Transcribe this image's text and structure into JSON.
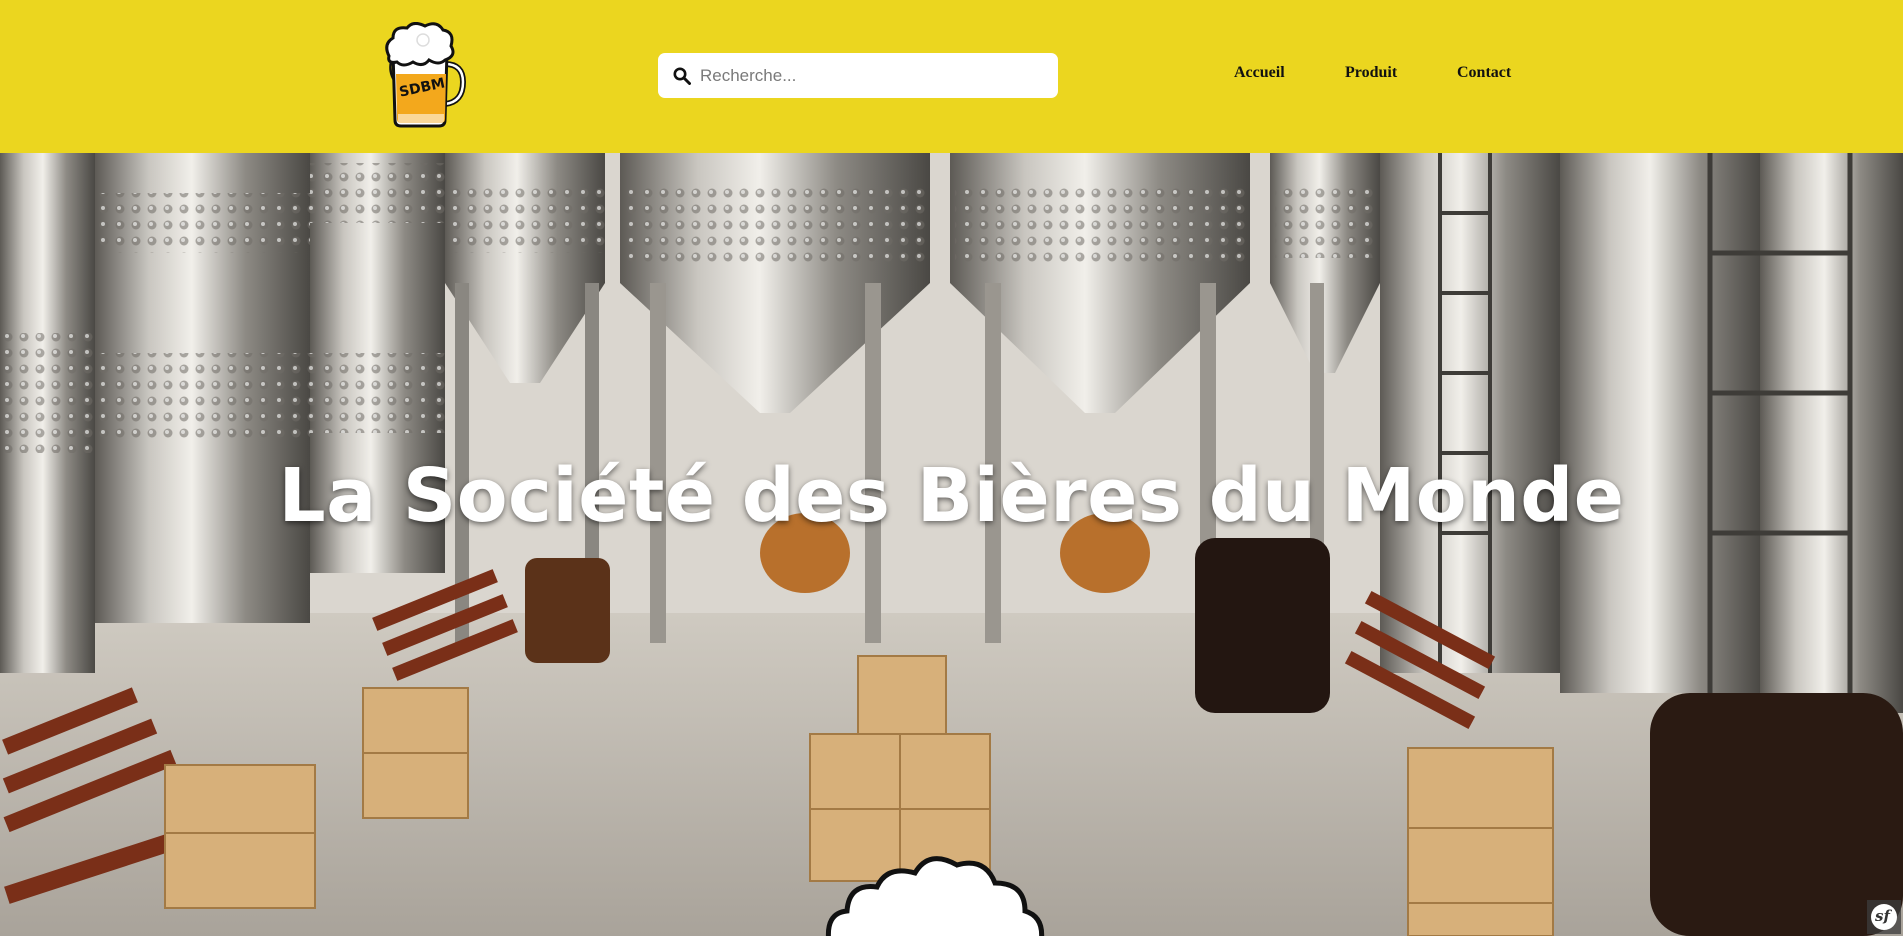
{
  "header": {
    "logo": {
      "text": "SDBM",
      "icon": "beer-mug-logo-icon"
    },
    "search": {
      "placeholder": "Recherche...",
      "value": "",
      "icon": "search-icon"
    },
    "nav": [
      {
        "label": "Accueil"
      },
      {
        "label": "Produit"
      },
      {
        "label": "Contact"
      }
    ]
  },
  "hero": {
    "title": "La Société des Bières du Monde",
    "decoration": "beer-foam-icon"
  },
  "toolbar": {
    "icon": "symfony-debug-icon",
    "label": "sf"
  },
  "colors": {
    "header_bg": "#ebd61f",
    "search_bg": "#ffffff",
    "nav_text": "#111111",
    "hero_text": "#ffffff"
  }
}
